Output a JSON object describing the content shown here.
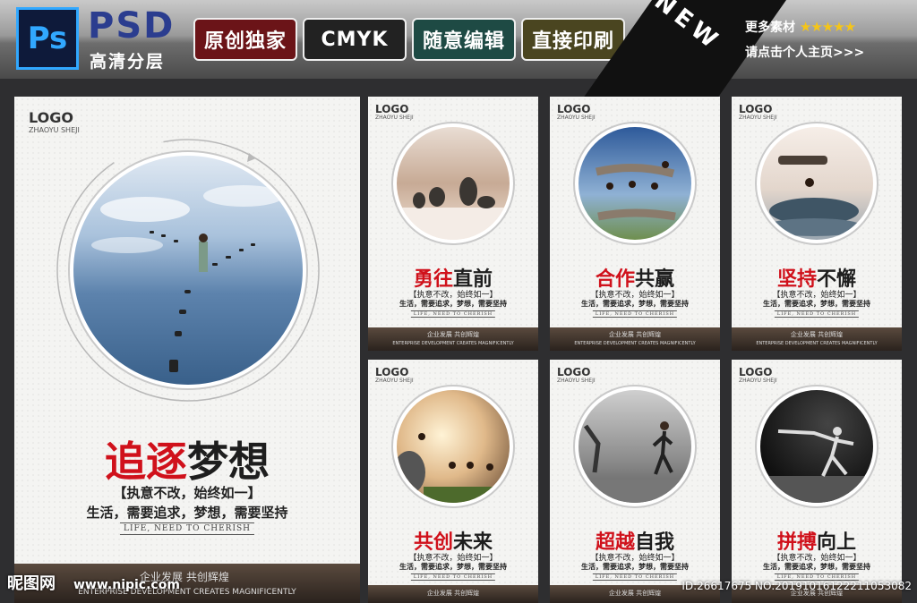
{
  "header": {
    "ps_icon": "Ps",
    "psd": "PSD",
    "psd_sub": "高清分层",
    "badges": [
      "原创独家",
      "CMYK",
      "随意编辑",
      "直接印刷"
    ],
    "badge_colors": [
      "#6b1418",
      "#222222",
      "#1e4a44",
      "#4a4520"
    ],
    "new_label": "NEW",
    "more_label": "更多素材",
    "stars": "★★★★★",
    "click_label": "请点击个人主页>>>"
  },
  "poster": {
    "logo": "LOGO",
    "logo_sub": "ZHAOYU SHEJI",
    "title_red": "追逐",
    "title_black": "梦想",
    "line1": "【执意不改，始终如一】",
    "line2": "生活，需要追求，梦想，需要坚持",
    "life": "LIFE, NEED TO CHERISH",
    "footer_cn": "企业发展  共创辉煌",
    "footer_en": "ENTERPRISE DEVELOPMENT CREATES MAGNIFICENTLY"
  },
  "cards": [
    {
      "logo": "LOGO",
      "logo_sub": "ZHAOYU SHEJI",
      "title_red": "勇往",
      "title_black": "直前",
      "line1": "【执意不改，始终如一】",
      "line2": "生活，需要追求，梦想，需要坚持",
      "life": "LIFE, NEED TO CHERISH",
      "footer_cn": "企业发展  共创辉煌",
      "footer_en": "ENTERPRISE DEVELOPMENT CREATES MAGNIFICENTLY"
    },
    {
      "logo": "LOGO",
      "logo_sub": "ZHAOYU SHEJI",
      "title_red": "合作",
      "title_black": "共赢",
      "line1": "【执意不改，始终如一】",
      "line2": "生活，需要追求，梦想，需要坚持",
      "life": "LIFE, NEED TO CHERISH",
      "footer_cn": "企业发展  共创辉煌",
      "footer_en": "ENTERPRISE DEVELOPMENT CREATES MAGNIFICENTLY"
    },
    {
      "logo": "LOGO",
      "logo_sub": "ZHAOYU SHEJI",
      "title_red": "坚持",
      "title_black": "不懈",
      "line1": "【执意不改，始终如一】",
      "line2": "生活，需要追求，梦想，需要坚持",
      "life": "LIFE, NEED TO CHERISH",
      "footer_cn": "企业发展  共创辉煌",
      "footer_en": "ENTERPRISE DEVELOPMENT CREATES MAGNIFICENTLY"
    },
    {
      "logo": "LOGO",
      "logo_sub": "ZHAOYU SHEJI",
      "title_red": "共创",
      "title_black": "未来",
      "line1": "【执意不改，始终如一】",
      "line2": "生活，需要追求，梦想，需要坚持",
      "life": "LIFE, NEED TO CHERISH",
      "footer_cn": "企业发展  共创辉煌"
    },
    {
      "logo": "LOGO",
      "logo_sub": "ZHAOYU SHEJI",
      "title_red": "超越",
      "title_black": "自我",
      "line1": "【执意不改，始终如一】",
      "line2": "生活，需要追求，梦想，需要坚持",
      "life": "LIFE, NEED TO CHERISH",
      "footer_cn": "企业发展  共创辉煌"
    },
    {
      "logo": "LOGO",
      "logo_sub": "ZHAOYU SHEJI",
      "title_red": "拼搏",
      "title_black": "向上",
      "line1": "【执意不改，始终如一】",
      "line2": "生活，需要追求，梦想，需要坚持",
      "life": "LIFE, NEED TO CHERISH",
      "footer_cn": "企业发展  共创辉煌"
    }
  ],
  "watermark": {
    "site": "昵图网",
    "url": "www.nipic.com",
    "id": "ID:26617675 NO:20191016122211053082"
  }
}
